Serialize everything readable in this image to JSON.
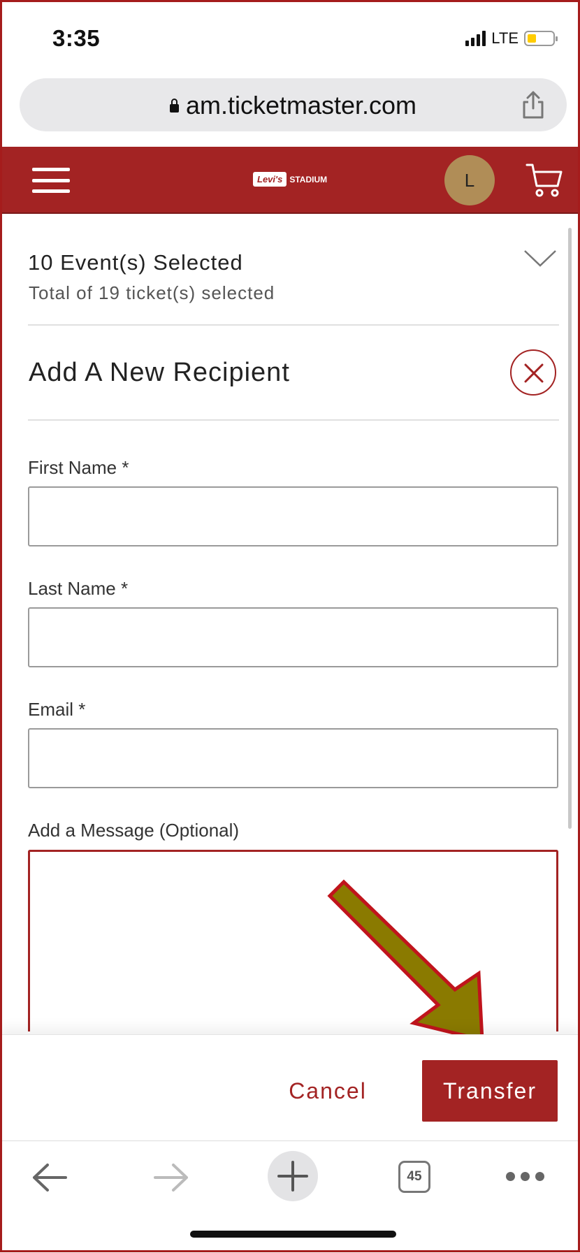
{
  "status_bar": {
    "time": "3:35",
    "network": "LTE",
    "battery_color": "#ffcc00"
  },
  "browser": {
    "url": "am.ticketmaster.com",
    "tab_count": "45"
  },
  "header": {
    "logo_badge": "Levi's",
    "logo_text": "STADIUM",
    "avatar_initial": "L",
    "brand_color": "#a32323"
  },
  "events": {
    "title": "10 Event(s) Selected",
    "subtitle": "Total of 19 ticket(s) selected"
  },
  "form": {
    "title": "Add A New Recipient",
    "first_name_label": "First Name *",
    "first_name_value": "",
    "last_name_label": "Last Name *",
    "last_name_value": "",
    "email_label": "Email *",
    "email_value": "",
    "message_label": "Add a Message (Optional)",
    "message_value": ""
  },
  "actions": {
    "cancel_label": "Cancel",
    "transfer_label": "Transfer"
  },
  "annotation": {
    "arrow_color": "#8a7a00",
    "arrow_outline": "#c0141c"
  }
}
